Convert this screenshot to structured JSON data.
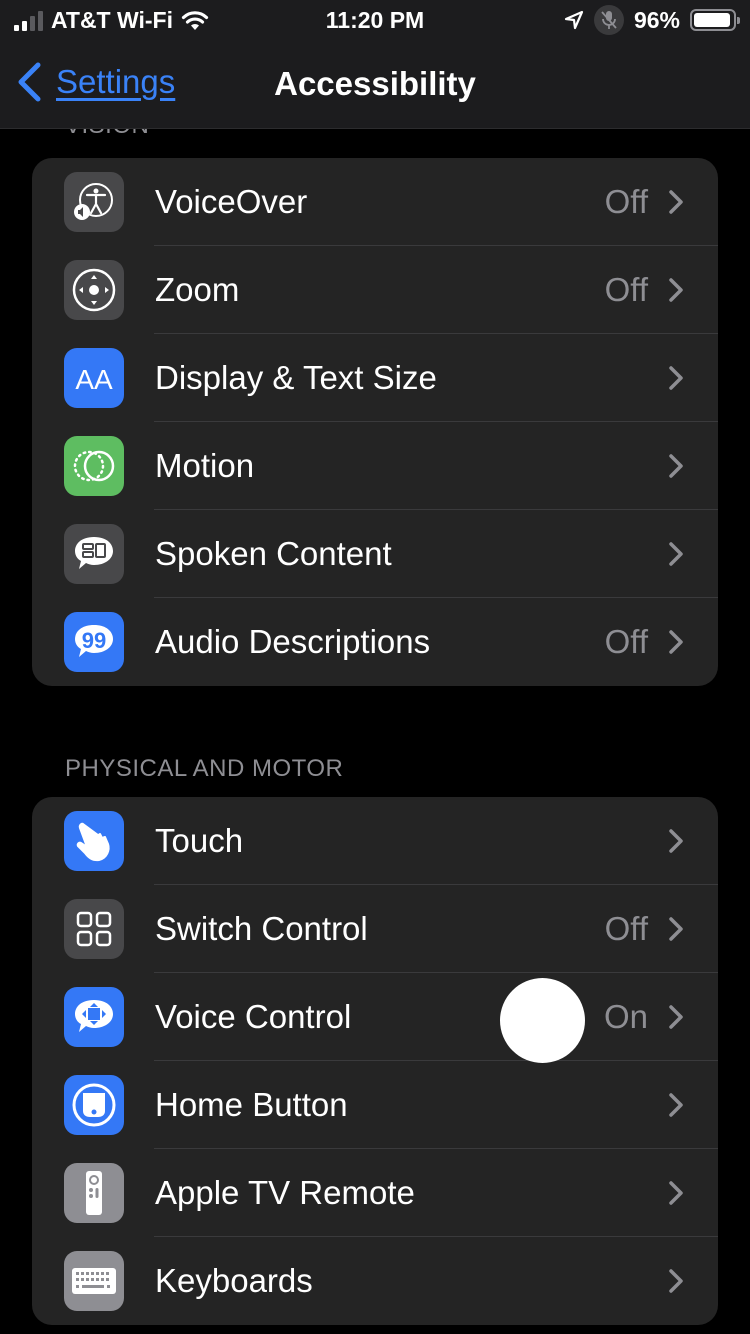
{
  "status_bar": {
    "carrier": "AT&T Wi-Fi",
    "time": "11:20 PM",
    "battery_percent_label": "96%",
    "battery_level": 0.96,
    "signal_bars_active": 2,
    "signal_bars_total": 4
  },
  "nav": {
    "back_label": "Settings",
    "title": "Accessibility"
  },
  "sections": [
    {
      "header": "VISION",
      "items": [
        {
          "label": "VoiceOver",
          "value": "Off",
          "icon": "voiceover-icon",
          "icon_bg": "#48484a"
        },
        {
          "label": "Zoom",
          "value": "Off",
          "icon": "zoom-icon",
          "icon_bg": "#48484a"
        },
        {
          "label": "Display & Text Size",
          "value": "",
          "icon": "text-size-icon",
          "icon_bg": "#3478f6"
        },
        {
          "label": "Motion",
          "value": "",
          "icon": "motion-icon",
          "icon_bg": "#5ebd61"
        },
        {
          "label": "Spoken Content",
          "value": "",
          "icon": "spoken-content-icon",
          "icon_bg": "#48484a"
        },
        {
          "label": "Audio Descriptions",
          "value": "Off",
          "icon": "audio-descriptions-icon",
          "icon_bg": "#3478f6"
        }
      ]
    },
    {
      "header": "PHYSICAL AND MOTOR",
      "items": [
        {
          "label": "Touch",
          "value": "",
          "icon": "touch-icon",
          "icon_bg": "#3478f6"
        },
        {
          "label": "Switch Control",
          "value": "Off",
          "icon": "switch-control-icon",
          "icon_bg": "#48484a"
        },
        {
          "label": "Voice Control",
          "value": "On",
          "icon": "voice-control-icon",
          "icon_bg": "#3478f6"
        },
        {
          "label": "Home Button",
          "value": "",
          "icon": "home-button-icon",
          "icon_bg": "#3478f6"
        },
        {
          "label": "Apple TV Remote",
          "value": "",
          "icon": "apple-tv-remote-icon",
          "icon_bg": "#8e8e93"
        },
        {
          "label": "Keyboards",
          "value": "",
          "icon": "keyboard-icon",
          "icon_bg": "#8e8e93"
        }
      ]
    }
  ],
  "colors": {
    "accent": "#3a82f7",
    "background": "#000000",
    "cell": "#242424",
    "secondary_text": "#8e8e93"
  }
}
